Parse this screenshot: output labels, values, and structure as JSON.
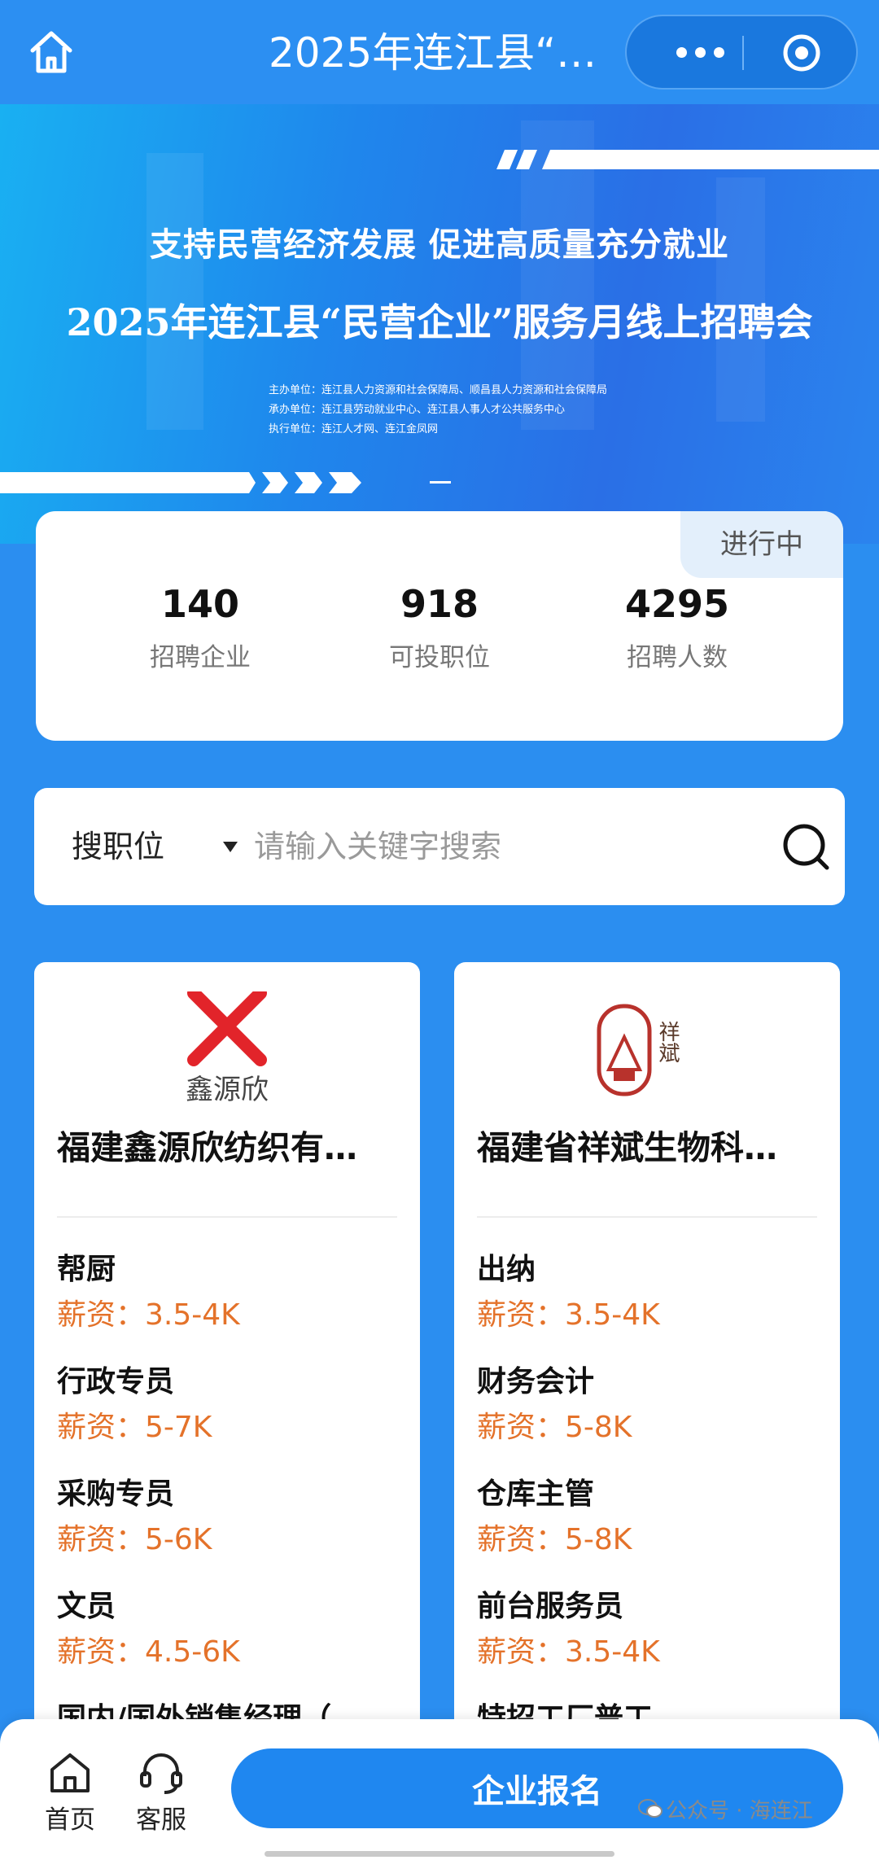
{
  "header": {
    "title": "2025年连江县“…",
    "home_icon": "home-icon",
    "more_icon": "more-dots-icon",
    "close_icon": "target-icon"
  },
  "banner": {
    "slogan": "支持民营经济发展 促进高质量充分就业",
    "event_title": "2025年连江县“民营企业”服务月线上招聘会",
    "host": "主办单位：连江县人力资源和社会保障局、顺昌县人力资源和社会保障局",
    "organizer": "承办单位：连江县劳动就业中心、连江县人事人才公共服务中心",
    "executor": "执行单位：连江人才网、连江金凤网"
  },
  "stats": {
    "status": "进行中",
    "items": [
      {
        "value": "140",
        "label": "招聘企业"
      },
      {
        "value": "918",
        "label": "可投职位"
      },
      {
        "value": "4295",
        "label": "招聘人数"
      }
    ]
  },
  "search": {
    "type_label": "搜职位",
    "placeholder": "请输入关键字搜索"
  },
  "companies": [
    {
      "logo_text": "鑫源欣",
      "name": "福建鑫源欣纺织有…",
      "jobs": [
        {
          "title": "帮厨",
          "salary": "薪资：3.5-4K"
        },
        {
          "title": "行政专员",
          "salary": "薪资：5-7K"
        },
        {
          "title": "采购专员",
          "salary": "薪资：5-6K"
        },
        {
          "title": "文员",
          "salary": "薪资：4.5-6K"
        },
        {
          "title": "国内/国外销售经理（…",
          "salary": ""
        }
      ]
    },
    {
      "logo_text": "祥斌",
      "name": "福建省祥斌生物科…",
      "jobs": [
        {
          "title": "出纳",
          "salary": "薪资：3.5-4K"
        },
        {
          "title": "财务会计",
          "salary": "薪资：5-8K"
        },
        {
          "title": "仓库主管",
          "salary": "薪资：5-8K"
        },
        {
          "title": "前台服务员",
          "salary": "薪资：3.5-4K"
        },
        {
          "title": "特招工厂普工",
          "salary": ""
        }
      ]
    }
  ],
  "bottom_nav": {
    "home": "首页",
    "service": "客服",
    "signup": "企业报名",
    "watermark": "公众号 · 海连江"
  },
  "colors": {
    "primary": "#2b8ef0",
    "salary": "#e4722a",
    "button": "#1f87f0"
  }
}
